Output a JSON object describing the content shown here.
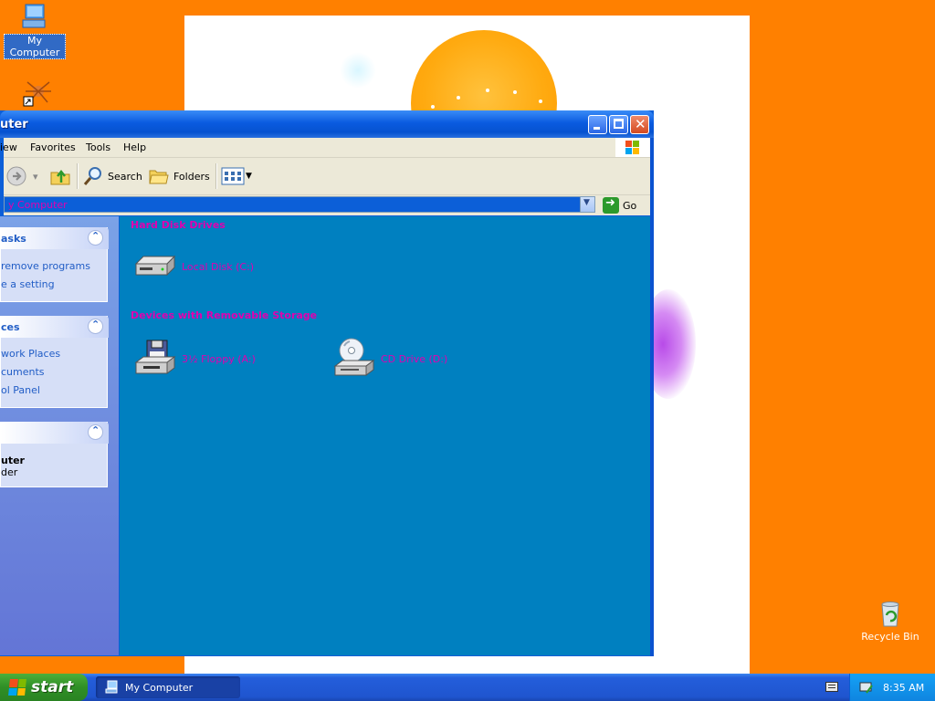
{
  "desktop": {
    "icons": [
      {
        "label": "My Computer",
        "icon": "my-computer-icon"
      },
      {
        "label": "",
        "icon": "shortcut-spider-icon"
      },
      {
        "label": "Recycle Bin",
        "icon": "recycle-bin-icon"
      }
    ],
    "background_color": "#ff8000"
  },
  "window": {
    "title": "uter",
    "menu": [
      "iew",
      "Favorites",
      "Tools",
      "Help"
    ],
    "toolbar": {
      "search_label": "Search",
      "folders_label": "Folders"
    },
    "address": {
      "value": "y Computer",
      "go_label": "Go"
    },
    "left_panels": [
      {
        "title": "asks",
        "links": [
          "remove programs",
          "e a setting"
        ]
      },
      {
        "title": "ces",
        "links": [
          "work Places",
          "cuments",
          "ol Panel"
        ]
      },
      {
        "title": "",
        "details": [
          "uter",
          "der"
        ]
      }
    ],
    "groups": [
      {
        "title": "Hard Disk Drives",
        "items": [
          {
            "label": "Local Disk (C:)",
            "icon": "hard-disk-icon"
          }
        ]
      },
      {
        "title": "Devices with Removable Storage",
        "items": [
          {
            "label": "3½ Floppy (A:)",
            "icon": "floppy-drive-icon"
          },
          {
            "label": "CD Drive (D:)",
            "icon": "cd-drive-icon"
          }
        ]
      }
    ],
    "colors": {
      "content_bg": "#0080c0",
      "label_text": "#e000b0"
    }
  },
  "taskbar": {
    "start_label": "start",
    "task_label": "My Computer",
    "clock": "8:35 AM"
  }
}
